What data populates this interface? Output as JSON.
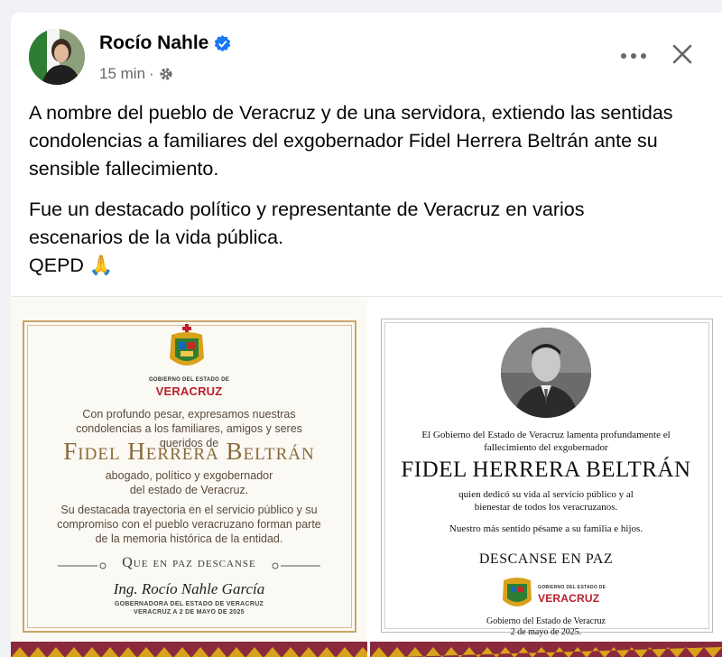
{
  "post": {
    "author": "Rocío Nahle",
    "time": "15 min",
    "paragraphs": [
      "A nombre del pueblo de Veracruz y de una servidora, extiendo las sentidas condolencias a familiares del exgobernador Fidel Herrera Beltrán ante su sensible fallecimiento.",
      "Fue un destacado político y representante de Veracruz en varios escenarios de la vida pública."
    ],
    "closing": "QEPD 🙏"
  },
  "left_card": {
    "gov_label": "GOBIERNO DEL ESTADO DE",
    "state": "VERACRUZ",
    "intro": "Con profundo pesar, expresamos nuestras condolencias a los familiares, amigos y seres queridos de",
    "name": "Fidel Herrera Beltrán",
    "role": "abogado, político y exgobernador del estado de Veracruz.",
    "legacy": "Su destacada trayectoria en el servicio público y su compromiso con el pueblo veracruzano forman parte de la memoria histórica de la entidad.",
    "rip": "Que en paz descanse",
    "signer": "Ing. Rocío Nahle García",
    "signer_title": "GOBERNADORA DEL ESTADO DE VERACRUZ",
    "date": "VERACRUZ A 2 DE MAYO DE 2025"
  },
  "right_card": {
    "intro": "El Gobierno del Estado de Veracruz lamenta profundamente el fallecimiento del exgobernador",
    "name": "FIDEL HERRERA BELTRÁN",
    "dedication": "quien dedicó su vida al servicio público y al bienestar de todos los veracruzanos.",
    "condolence": "Nuestro más sentido pésame a su familia e hijos.",
    "rip": "DESCANSE EN PAZ",
    "gov_label": "GOBIERNO DEL ESTADO DE",
    "state": "VERACRUZ",
    "footer": "Gobierno del Estado de Veracruz",
    "date": "2 de mayo de 2025."
  },
  "colors": {
    "verified": "#1877f2",
    "muted": "#65676b",
    "gold": "#c9a66b",
    "veracruz_red": "#b8202c"
  },
  "icons": [
    "verified-badge-icon",
    "gear-icon",
    "more-options-icon",
    "close-icon",
    "coat-of-arms-icon"
  ]
}
